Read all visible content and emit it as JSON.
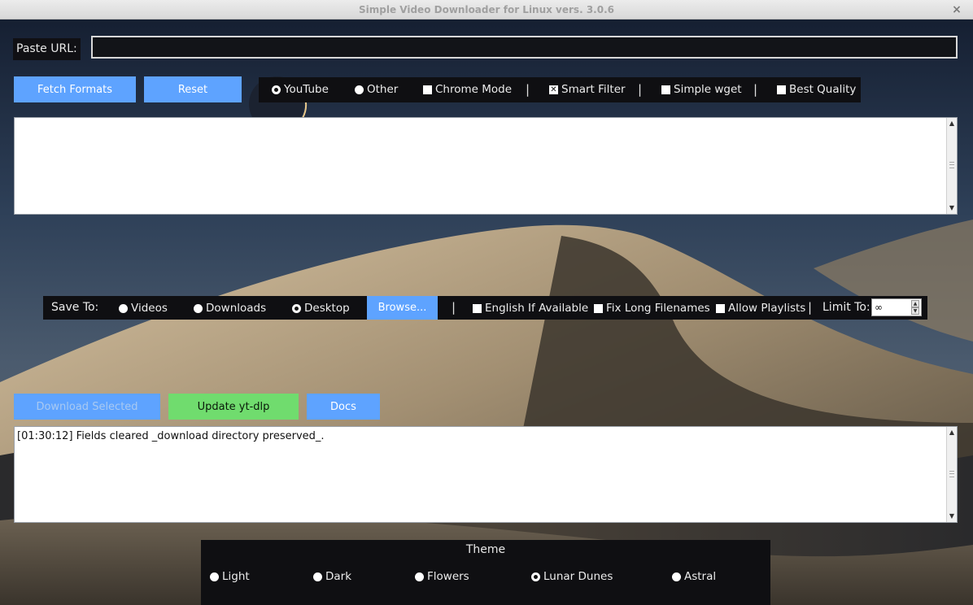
{
  "window": {
    "title": "Simple Video Downloader for Linux vers. 3.0.6",
    "close_glyph": "×"
  },
  "url": {
    "label": "Paste URL:",
    "value": "",
    "placeholder": ""
  },
  "actions": {
    "fetch_label": "Fetch Formats",
    "reset_label": "Reset"
  },
  "source_options": {
    "youtube": "YouTube",
    "other": "Other",
    "chrome_mode": "Chrome Mode",
    "smart_filter": "Smart Filter",
    "simple_wget": "Simple wget",
    "best_quality": "Best Quality",
    "separator": "|"
  },
  "save": {
    "label": "Save To:",
    "videos": "Videos",
    "downloads": "Downloads",
    "desktop": "Desktop",
    "browse_label": "Browse...",
    "english": "English If Available",
    "fix_long": "Fix Long Filenames",
    "allow_playlists": "Allow Playlists",
    "limit_label": "Limit To:",
    "limit_value": "∞"
  },
  "bottom_actions": {
    "download_label": "Download Selected",
    "update_label": "Update yt-dlp",
    "docs_label": "Docs"
  },
  "log": {
    "line1": "[01:30:12] Fields cleared _download directory preserved_."
  },
  "theme": {
    "title": "Theme",
    "light": "Light",
    "dark": "Dark",
    "flowers": "Flowers",
    "lunar_dunes": "Lunar Dunes",
    "astral": "Astral"
  },
  "colors": {
    "accent": "#5ea3ff",
    "update": "#70dc6e",
    "panel": "#0f0f12"
  },
  "state": {
    "source": "youtube",
    "smart_filter": true,
    "chrome_mode": false,
    "simple_wget": false,
    "best_quality": false,
    "save_to": "desktop",
    "english": false,
    "fix_long": false,
    "allow_playlists": false,
    "theme": "lunar_dunes"
  }
}
